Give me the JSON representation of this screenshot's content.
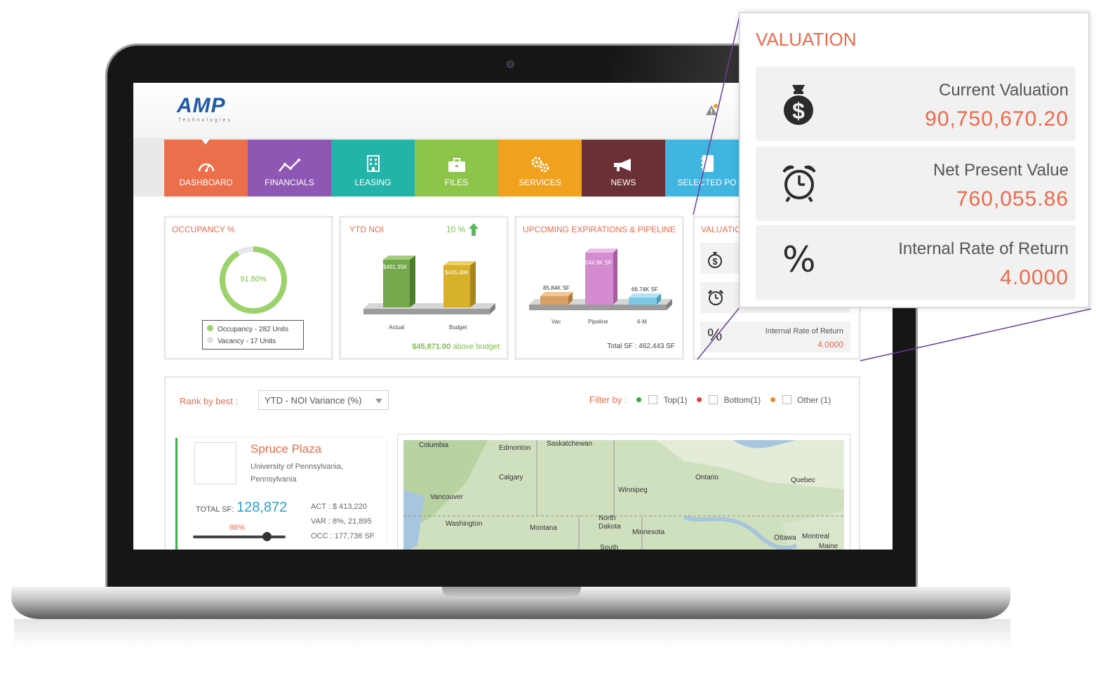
{
  "app": {
    "logo_text": "AMP",
    "logo_subtext": "Technologies"
  },
  "nav": {
    "items": [
      {
        "label": "DASHBOARD",
        "color": "#ec6f4c",
        "icon": "gauge-icon"
      },
      {
        "label": "FINANCIALS",
        "color": "#8e57b4",
        "icon": "line-chart-icon"
      },
      {
        "label": "LEASING",
        "color": "#24b3a9",
        "icon": "building-icon"
      },
      {
        "label": "FILES",
        "color": "#8dc54b",
        "icon": "briefcase-icon"
      },
      {
        "label": "SERVICES",
        "color": "#f0a11e",
        "icon": "gears-icon"
      },
      {
        "label": "NEWS",
        "color": "#6b3035",
        "icon": "megaphone-icon"
      },
      {
        "label": "SELECTED PO",
        "color": "#3fb5e0",
        "icon": "notebook-icon"
      }
    ]
  },
  "occupancy": {
    "title": "OCCUPANCY %",
    "percent": "91.80%",
    "legend_occupancy": "Occupancy - 282 Units",
    "legend_vacancy": "Vacancy - 17 Units"
  },
  "ytd_noi": {
    "title": "YTD NOI",
    "change": "10 %",
    "bars": [
      {
        "label": "Actual",
        "value_label": "$491.35K"
      },
      {
        "label": "Budget",
        "value_label": "$445.48K"
      }
    ],
    "footer_amount": "$45,871.00",
    "footer_text": "above budget"
  },
  "expirations": {
    "title": "UPCOMING EXPIRATIONS & PIPELINE",
    "bars": [
      {
        "label": "Vac",
        "value_label": "85.84K SF"
      },
      {
        "label": "Pipeline",
        "value_label": "544.9K SF"
      },
      {
        "label": "6-M",
        "value_label": "66.74K SF"
      }
    ],
    "footer": "Total SF : 462,443 SF"
  },
  "valuation_mini": {
    "title": "VALUATIO",
    "irr_label": "Internal Rate of Return",
    "irr_value": "4.0000"
  },
  "filters": {
    "rank_label": "Rank by best :",
    "rank_value": "YTD - NOI Variance (%)",
    "filter_label": "Filter by :",
    "options": [
      {
        "label": "Top(1)",
        "color": "#2eaa3a"
      },
      {
        "label": "Bottom(1)",
        "color": "#e53b3b"
      },
      {
        "label": "Other (1)",
        "color": "#f08c1e"
      }
    ]
  },
  "property": {
    "name": "Spruce Plaza",
    "address": "University of Pennsylvania, Pennsylvania",
    "total_sf_label": "TOTAL SF:",
    "total_sf": "128,872",
    "percent": "86%",
    "act": "ACT : $ 413,220",
    "var": "VAR :   8%, 21,895",
    "occ": "OCC : 177,738 SF"
  },
  "map_labels": [
    "Columbia",
    "Edmonton",
    "Saskatchewan",
    "Calgary",
    "Vancouver",
    "Washington",
    "Montana",
    "Winnipeg",
    "North Dakota",
    "Minnesota",
    "Ontario",
    "Quebec",
    "Ottawa",
    "Montreal",
    "Maine",
    "South"
  ],
  "callout": {
    "title": "VALUATION",
    "rows": [
      {
        "label": "Current Valuation",
        "value": "90,750,670.20",
        "icon": "money-bag-icon"
      },
      {
        "label": "Net Present Value",
        "value": "760,055.86",
        "icon": "alarm-clock-icon"
      },
      {
        "label": "Internal Rate of Return",
        "value": "4.0000",
        "icon": "percent-icon"
      }
    ]
  }
}
